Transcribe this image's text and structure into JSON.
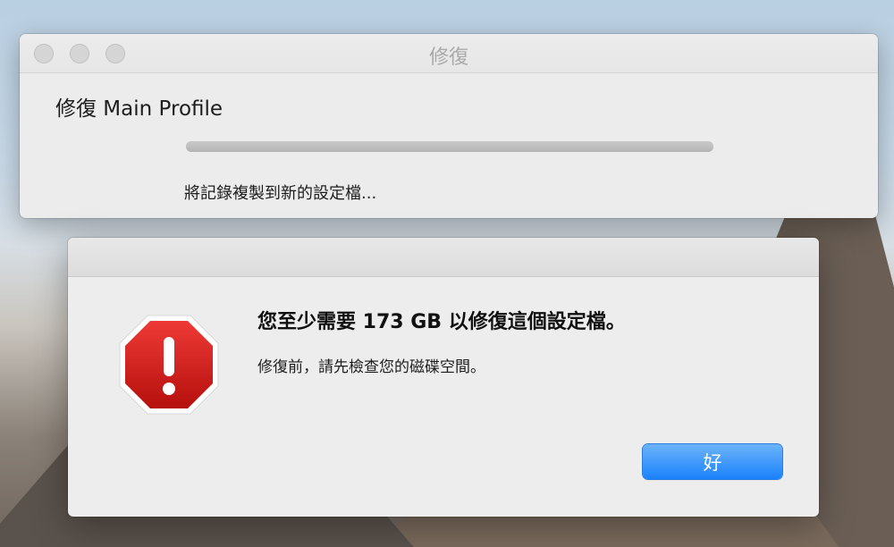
{
  "progress_window": {
    "title": "修復",
    "heading": "修復 Main Profile",
    "progress_fraction": 1.0,
    "status": "將記錄複製到新的設定檔..."
  },
  "alert": {
    "icon": "stop-sign-exclamation-icon",
    "title": "您至少需要 173 GB 以修復這個設定檔。",
    "message": "修復前，請先檢查您的磁碟空間。",
    "ok_label": "好",
    "accent": "#1a82fb"
  }
}
